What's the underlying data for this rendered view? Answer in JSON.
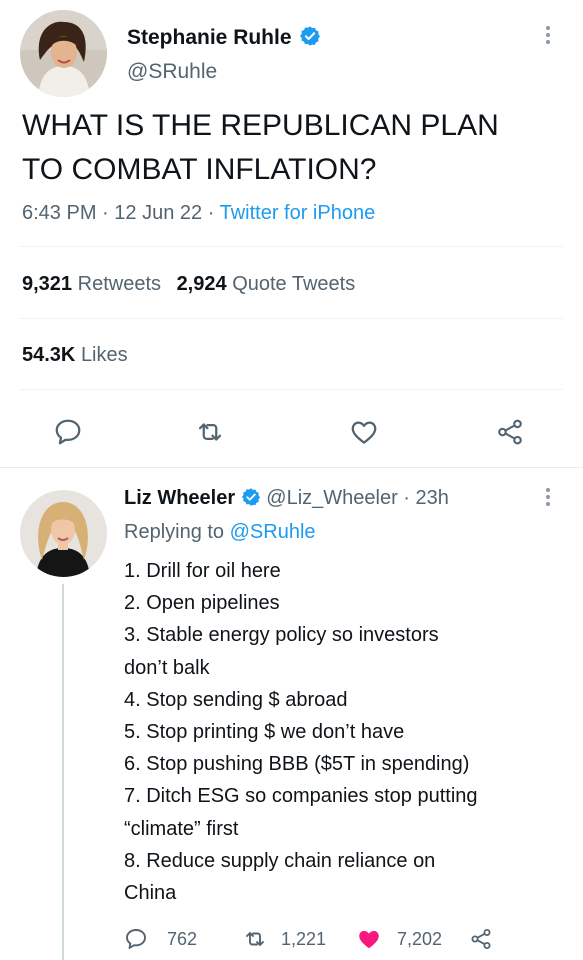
{
  "main_tweet": {
    "author_name": "Stephanie Ruhle",
    "author_handle": "@SRuhle",
    "text_line1": "WHAT IS THE REPUBLICAN PLAN",
    "text_line2": "TO COMBAT INFLATION?",
    "time": "6:43 PM",
    "sep1": "·",
    "date": "12 Jun 22",
    "sep2": "·",
    "source": "Twitter for iPhone",
    "retweets_count": "9,321",
    "retweets_label": "Retweets",
    "quotes_count": "2,924",
    "quotes_label": "Quote Tweets",
    "likes_count": "54.3K",
    "likes_label": "Likes"
  },
  "reply": {
    "author_name": "Liz Wheeler",
    "author_handle": "@Liz_Wheeler",
    "sep": "·",
    "age": "23h",
    "replying_label": "Replying to",
    "replying_handle": "@SRuhle",
    "lines": [
      "1. Drill for oil here",
      "2. Open pipelines",
      "3. Stable energy policy so investors",
      "don’t balk",
      "4. Stop sending $ abroad",
      "5. Stop printing $ we don’t have",
      "6. Stop pushing BBB ($5T in spending)",
      "7. Ditch ESG so companies stop putting",
      "“climate” first",
      "8. Reduce supply chain reliance on",
      "China"
    ],
    "reply_count": "762",
    "retweet_count": "1,221",
    "like_count": "7,202"
  },
  "colors": {
    "verified": "#1d9bf0",
    "link": "#1d9bf0",
    "liked_heart": "#f91880",
    "muted": "#536471"
  }
}
